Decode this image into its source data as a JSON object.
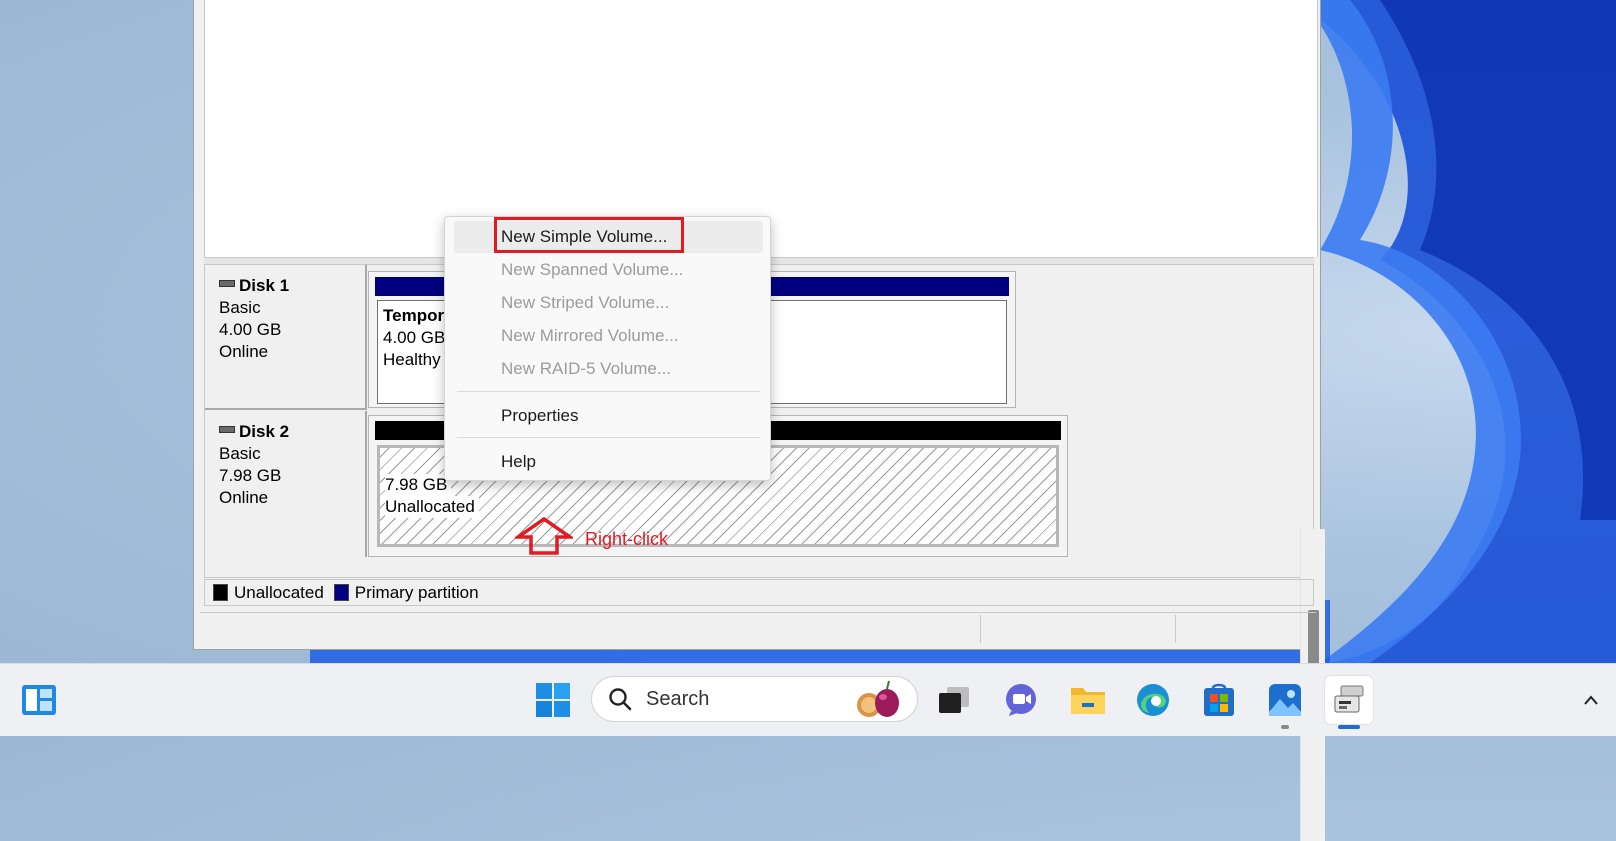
{
  "disk_management": {
    "disks": [
      {
        "name": "Disk 1",
        "type": "Basic",
        "size": "4.00 GB",
        "status": "Online",
        "partition": {
          "label": "Tempor",
          "size": "4.00 GB",
          "status": "Healthy"
        }
      },
      {
        "name": "Disk 2",
        "type": "Basic",
        "size": "7.98 GB",
        "status": "Online",
        "partition": {
          "size": "7.98 GB",
          "status": "Unallocated"
        }
      }
    ],
    "legend": [
      {
        "label": "Unallocated",
        "color": "#000000"
      },
      {
        "label": "Primary partition",
        "color": "#000080"
      }
    ]
  },
  "context_menu": {
    "items": [
      {
        "label": "New Simple Volume...",
        "enabled": true,
        "highlighted": true
      },
      {
        "label": "New Spanned Volume...",
        "enabled": false
      },
      {
        "label": "New Striped Volume...",
        "enabled": false
      },
      {
        "label": "New Mirrored Volume...",
        "enabled": false
      },
      {
        "label": "New RAID-5 Volume...",
        "enabled": false
      },
      {
        "label": "Properties",
        "enabled": true
      },
      {
        "label": "Help",
        "enabled": true
      }
    ]
  },
  "annotation": {
    "text": "Right-click",
    "color": "#e01b24"
  },
  "taskbar": {
    "search_placeholder": "Search",
    "icons": [
      "widgets-icon",
      "start-icon",
      "task-view-icon",
      "chat-icon",
      "file-explorer-icon",
      "edge-icon",
      "store-icon",
      "photos-icon",
      "disk-management-icon",
      "show-hidden-icons-chevron"
    ]
  }
}
